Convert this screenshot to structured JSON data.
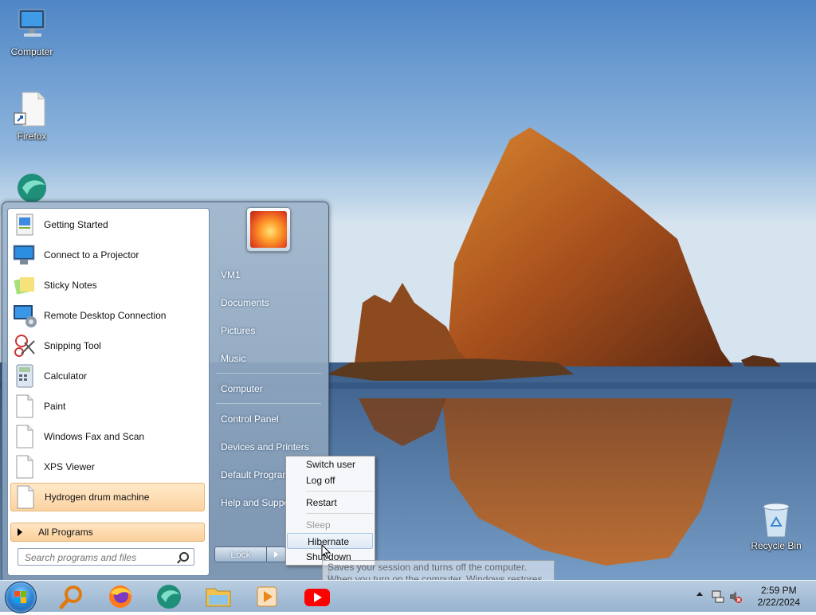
{
  "desktop": {
    "icons": [
      {
        "label": "Computer",
        "icon": "computer-icon"
      },
      {
        "label": "Firefox",
        "icon": "firefox-shortcut-icon"
      },
      {
        "label": "",
        "icon": "browser-globe-icon"
      },
      {
        "label": "Recycle Bin",
        "icon": "recycle-bin-icon"
      }
    ]
  },
  "start_menu": {
    "programs": [
      {
        "label": "Getting Started",
        "icon": "getting-started-icon"
      },
      {
        "label": "Connect to a Projector",
        "icon": "projector-icon"
      },
      {
        "label": "Sticky Notes",
        "icon": "sticky-notes-icon"
      },
      {
        "label": "Remote Desktop Connection",
        "icon": "remote-desktop-icon"
      },
      {
        "label": "Snipping Tool",
        "icon": "scissors-icon"
      },
      {
        "label": "Calculator",
        "icon": "calculator-icon"
      },
      {
        "label": "Paint",
        "icon": "document-icon"
      },
      {
        "label": "Windows Fax and Scan",
        "icon": "document-icon"
      },
      {
        "label": "XPS Viewer",
        "icon": "document-icon"
      },
      {
        "label": "Hydrogen drum machine",
        "icon": "document-icon",
        "highlighted": true
      }
    ],
    "all_programs": "All Programs",
    "search_placeholder": "Search programs and files",
    "right_links": {
      "user": "VM1",
      "documents": "Documents",
      "pictures": "Pictures",
      "music": "Music",
      "computer": "Computer",
      "control_panel": "Control Panel",
      "devices": "Devices and Printers",
      "default_programs": "Default Programs",
      "help": "Help and Support"
    },
    "lock_button": "Lock"
  },
  "power_menu": {
    "items": [
      {
        "label": "Switch user",
        "enabled": true
      },
      {
        "label": "Log off",
        "enabled": true
      },
      {
        "label": "Restart",
        "enabled": true
      },
      {
        "label": "Sleep",
        "enabled": false
      },
      {
        "label": "Hibernate",
        "enabled": true,
        "highlighted": true
      },
      {
        "label": "Shut down",
        "enabled": true
      }
    ]
  },
  "tooltip": {
    "text": "Saves your session and turns off the computer. When you turn on the computer, Windows restores your session."
  },
  "taskbar": {
    "pinned": [
      "search-icon",
      "firefox-icon",
      "browser-globe-icon",
      "file-explorer-icon",
      "media-player-icon",
      "youtube-icon"
    ],
    "clock_time": "2:59 PM",
    "clock_date": "2/22/2024"
  },
  "colors": {
    "highlight": "#fcd3a1",
    "taskbar": "#a9c1d9"
  }
}
